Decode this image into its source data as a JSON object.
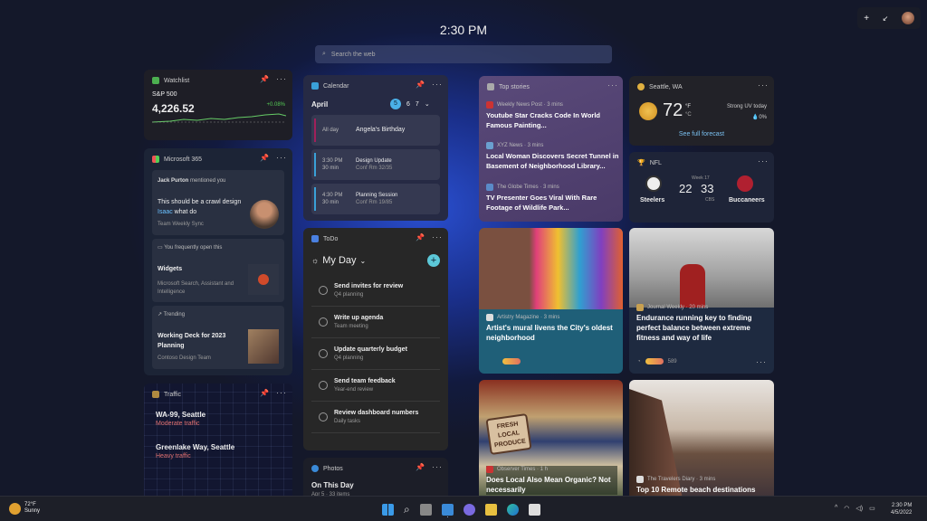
{
  "clock": "2:30 PM",
  "search": {
    "placeholder": "Search the web"
  },
  "top_controls": {
    "add": "+",
    "collapse": "↙"
  },
  "watchlist": {
    "title": "Watchlist",
    "symbol": "S&P 500",
    "value": "4,226.52",
    "change": "+0.08%"
  },
  "m365": {
    "title": "Microsoft 365",
    "mention": {
      "name": "Jack Purton",
      "action": "mentioned you",
      "text_pre": "This should be a crawl design ",
      "highlight": "Isaac",
      "text_post": " what do",
      "source": "Team Weekly Sync"
    },
    "frequent": {
      "label": "You frequently open this",
      "title": "Widgets",
      "desc": "Microsoft Search, Assistant and Intelligence"
    },
    "trending": {
      "label": "Trending",
      "title": "Working Deck for 2023 Planning",
      "team": "Contoso Design Team"
    }
  },
  "traffic": {
    "title": "Traffic",
    "routes": [
      {
        "name": "WA-99, Seattle",
        "status": "Moderate traffic"
      },
      {
        "name": "Greenlake Way, Seattle",
        "status": "Heavy traffic"
      }
    ]
  },
  "calendar": {
    "title": "Calendar",
    "month": "April",
    "days": [
      "5",
      "6",
      "7"
    ],
    "events": [
      {
        "time": "All day",
        "dur": "",
        "title": "Angela's Birthday",
        "loc": "",
        "color": "#a0205a"
      },
      {
        "time": "3:30 PM",
        "dur": "30 min",
        "title": "Design Update",
        "loc": "Conf Rm 32/35",
        "color": "#3aa0d8"
      },
      {
        "time": "4:30 PM",
        "dur": "30 min",
        "title": "Planning Session",
        "loc": "Conf Rm 19/85",
        "color": "#3aa0d8"
      }
    ]
  },
  "todo": {
    "title": "ToDo",
    "list": "My Day",
    "add": "+",
    "tasks": [
      {
        "name": "Send invites for review",
        "sub": "Q4 planning"
      },
      {
        "name": "Write up agenda",
        "sub": "Team meeting"
      },
      {
        "name": "Update quarterly budget",
        "sub": "Q4 planning"
      },
      {
        "name": "Send team feedback",
        "sub": "Year-end review"
      },
      {
        "name": "Review dashboard numbers",
        "sub": "Daily tasks"
      }
    ]
  },
  "photos": {
    "title": "Photos",
    "heading": "On This Day",
    "sub": "Apr 5 · 33 items"
  },
  "top_stories": {
    "title": "Top stories",
    "items": [
      {
        "source": "Weekly News Post · 3 mins",
        "title": "Youtube Star Cracks Code In World Famous Painting..."
      },
      {
        "source": "XYZ News · 3 mins",
        "title": "Local Woman Discovers Secret Tunnel in Basement of Neighborhood Library..."
      },
      {
        "source": "The Globe Times · 3 mins",
        "title": "TV Presenter Goes Viral With Rare Footage of Wildlife Park..."
      }
    ]
  },
  "weather": {
    "location": "Seattle, WA",
    "temp": "72",
    "unit_f": "°F",
    "unit_c": "°C",
    "uv": "Strong UV today",
    "precip": "0%",
    "link": "See full forecast"
  },
  "nfl": {
    "title": "NFL",
    "week": "Week 17",
    "home": "Steelers",
    "away": "Buccaneers",
    "home_score": "22",
    "away_score": "33",
    "network": "CBS"
  },
  "news": [
    {
      "source": "Artistry Magazine · 3 mins",
      "title": "Artist's mural livens the City's oldest neighborhood"
    },
    {
      "source": "Journal Weekly · 20 mins",
      "title": "Endurance running key to finding perfect balance between extreme fitness and way of life",
      "reactions": "589"
    },
    {
      "source": "Observer Times · 1 h",
      "title": "Does Local Also Mean Organic? Not necessarily",
      "image_text": "FRESH LOCAL PRODUCE"
    },
    {
      "source": "The Travelers Diary · 3 mins",
      "title": "Top 10 Remote beach destinations"
    }
  ],
  "taskbar": {
    "weather_temp": "72°F",
    "weather_cond": "Sunny",
    "time": "2:30 PM",
    "date": "4/5/2022"
  }
}
